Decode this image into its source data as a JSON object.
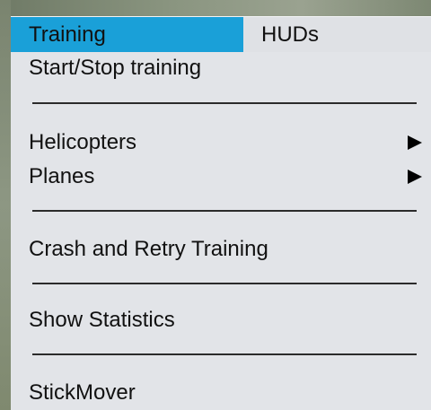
{
  "menubar": {
    "tabs": [
      {
        "label": "Training",
        "active": true
      },
      {
        "label": "HUDs",
        "active": false
      }
    ]
  },
  "menu": {
    "items": [
      {
        "label": "Start/Stop training"
      },
      {
        "label": "Helicopters",
        "submenu": true
      },
      {
        "label": "Planes",
        "submenu": true
      },
      {
        "label": "Crash and Retry Training"
      },
      {
        "label": "Show Statistics"
      },
      {
        "label": "StickMover"
      }
    ]
  },
  "colors": {
    "active_tab": "#1aa0d8",
    "menu_background": "#e2e4e8",
    "separator": "#2b2b2b"
  }
}
